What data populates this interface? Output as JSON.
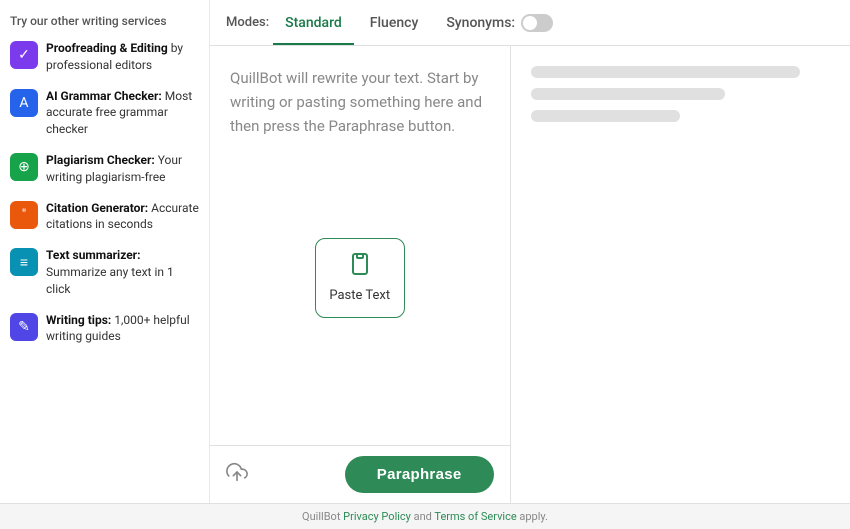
{
  "sidebar": {
    "title": "Try our other writing services",
    "items": [
      {
        "id": "proofreading",
        "icon": "✓",
        "iconClass": "icon-purple",
        "label_strong": "Proofreading & Editing",
        "label_rest": " by professional editors"
      },
      {
        "id": "grammar",
        "icon": "A",
        "iconClass": "icon-blue",
        "label_strong": "AI Grammar Checker:",
        "label_rest": " Most accurate free grammar checker"
      },
      {
        "id": "plagiarism",
        "icon": "⊕",
        "iconClass": "icon-green",
        "label_strong": "Plagiarism Checker:",
        "label_rest": " Your writing plagiarism-free"
      },
      {
        "id": "citation",
        "icon": "\"",
        "iconClass": "icon-orange",
        "label_strong": "Citation Generator:",
        "label_rest": " Accurate citations in seconds"
      },
      {
        "id": "summarizer",
        "icon": "≡",
        "iconClass": "icon-teal",
        "label_strong": "Text summarizer:",
        "label_rest": " Summarize any text in 1 click"
      },
      {
        "id": "writing-tips",
        "icon": "✎",
        "iconClass": "icon-indigo",
        "label_strong": "Writing tips:",
        "label_rest": " 1,000+ helpful writing guides"
      }
    ]
  },
  "tabs": {
    "label": "Modes:",
    "items": [
      {
        "id": "standard",
        "label": "Standard",
        "active": true
      },
      {
        "id": "fluency",
        "label": "Fluency",
        "active": false
      },
      {
        "id": "synonyms",
        "label": "Synonyms:",
        "active": false
      }
    ]
  },
  "editor": {
    "placeholder": "QuillBot will rewrite your text. Start by writing or pasting something here and then press the Paraphrase button.",
    "paste_label": "Paste Text",
    "paraphrase_label": "Paraphrase"
  },
  "footer": {
    "text_before": "QuillBot ",
    "privacy_label": "Privacy Policy",
    "text_mid": " and ",
    "terms_label": "Terms of Service",
    "text_after": " apply."
  }
}
